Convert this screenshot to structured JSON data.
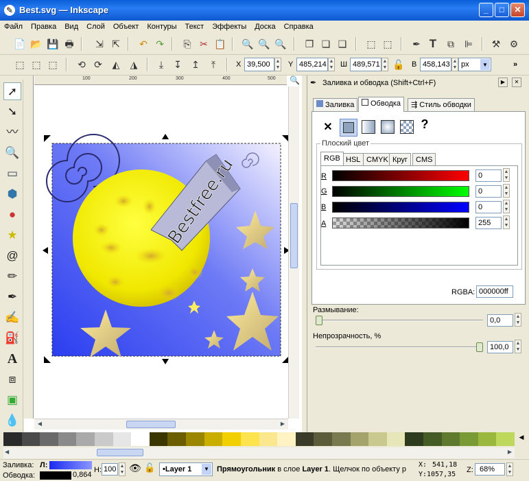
{
  "window": {
    "title": "Best.svg — Inkscape",
    "minimize": "_",
    "maximize": "□",
    "close": "✕"
  },
  "menu": [
    "Файл",
    "Правка",
    "Вид",
    "Слой",
    "Объект",
    "Контуры",
    "Текст",
    "Эффекты",
    "Доска",
    "Справка"
  ],
  "toolbar2": {
    "x_label": "X",
    "x_value": "39,500",
    "y_label": "Y",
    "y_value": "485,214",
    "w_label": "Ш",
    "w_value": "489,571",
    "h_label": "В",
    "h_value": "458,143",
    "unit": "px",
    "more": "»"
  },
  "ruler_ticks": [
    "100",
    "200",
    "300",
    "400",
    "500"
  ],
  "drawing": {
    "text": "Bestfree.ru"
  },
  "panel": {
    "title": "Заливка и обводка (Shift+Ctrl+F)",
    "tabs": [
      "Заливка",
      "Обводка",
      "Стиль обводки"
    ],
    "paint_types": [
      "✕",
      "?"
    ],
    "flat_color_label": "Плоский цвет",
    "color_tabs": [
      "RGB",
      "HSL",
      "CMYK",
      "Круг",
      "CMS"
    ],
    "channels": [
      {
        "label": "R",
        "value": "0"
      },
      {
        "label": "G",
        "value": "0"
      },
      {
        "label": "B",
        "value": "0"
      },
      {
        "label": "A",
        "value": "255"
      }
    ],
    "rgba_label": "RGBA:",
    "rgba_value": "000000ff",
    "blur_label": "Размывание:",
    "blur_value": "0,0",
    "blur_level": 0,
    "opacity_label": "Непрозрачность, %",
    "opacity_value": "100,0",
    "opacity_level": 1
  },
  "palette_colors": [
    "#2a2a2a",
    "#4a4a4a",
    "#6a6a6a",
    "#8a8a8a",
    "#aaaaaa",
    "#cacaca",
    "#e6e6e6",
    "#ffffff",
    "#3b3500",
    "#6b5e00",
    "#9b8600",
    "#c9ae00",
    "#f2d000",
    "#fde34d",
    "#fbe88e",
    "#fff3c4",
    "#3b3b2a",
    "#5c5c3a",
    "#7a7a50",
    "#a3a36b",
    "#c9c98f",
    "#e6e6b8",
    "#2f3b1f",
    "#465c27",
    "#5f7a2e",
    "#7a9a35",
    "#9ab83d",
    "#bdd85a"
  ],
  "status": {
    "fill_label": "Заливка:",
    "fill_short": "Л:",
    "stroke_label": "Обводка:",
    "stroke_width": "0,864",
    "h_label": "Н:",
    "h_value": "100",
    "layer": "•Layer 1",
    "message_bold": "Прямоугольник",
    "message": " в слое ",
    "message_layer": "Layer 1",
    ". ": "",
    "message_tail": ". Щелчок по объекту р",
    "x_label": "X:",
    "x_value": "541,18",
    "y_label": "Y:",
    "y_value": "1057,35",
    "z_label": "Z:",
    "zoom": "68%"
  }
}
